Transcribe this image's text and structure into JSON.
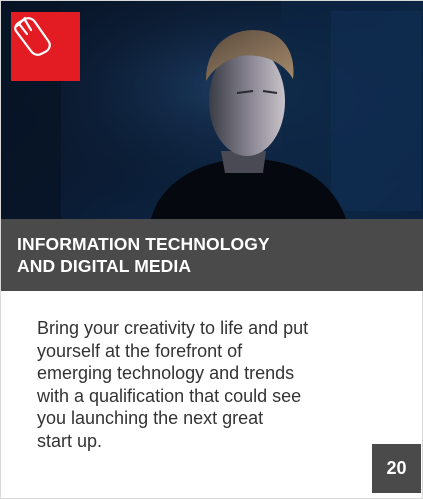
{
  "card": {
    "icon": "computer-mouse-icon",
    "accent_color": "#e31b23",
    "banner_color": "#4a4a4a",
    "title_lines": [
      "INFORMATION TECHNOLOGY",
      "AND DIGITAL MEDIA"
    ],
    "body_lines": [
      "Bring your creativity to life and put",
      "yourself at the forefront of",
      "emerging technology and trends",
      "with a qualification that could see",
      "you launching the next great",
      "start up."
    ],
    "page_number": "20"
  }
}
